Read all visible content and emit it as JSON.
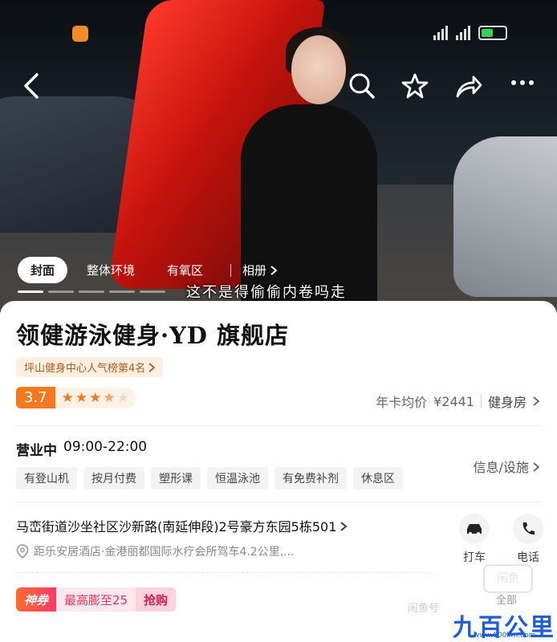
{
  "hero": {
    "tabs": [
      "封面",
      "整体环境",
      "有氧区"
    ],
    "album_label": "相册",
    "caption": "这不是得偷偷内卷吗走"
  },
  "store": {
    "name": "领健游泳健身·YD 旗舰店",
    "rank": "坪山健身中心人气榜第4名",
    "score": "3.7",
    "stars": "★★★★☆",
    "price_label": "年卡均价",
    "price_value": "¥2441",
    "category": "健身房"
  },
  "hours": {
    "status": "营业中",
    "time": "09:00-22:00"
  },
  "tags": [
    "有登山机",
    "按月付费",
    "塑形课",
    "恒温泳池",
    "有免费补剂",
    "休息区"
  ],
  "info_link": "信息/设施",
  "address": {
    "line": "马峦街道沙坐社区沙新路(南延伸段)2号豪方东园5栋501",
    "distance": "距乐安居酒店·金港丽都国际水疗会所驾车4.2公里,..."
  },
  "actions": {
    "taxi": "打车",
    "phone": "电话"
  },
  "promo": {
    "badge": "神券",
    "text": "最高膨至25",
    "button": "抢购"
  },
  "more_label": "全部",
  "watermarks": {
    "stamp": "闲鱼",
    "account": "闲鱼号",
    "site_name": "九百公里",
    "site_url": "www.600km.com"
  }
}
